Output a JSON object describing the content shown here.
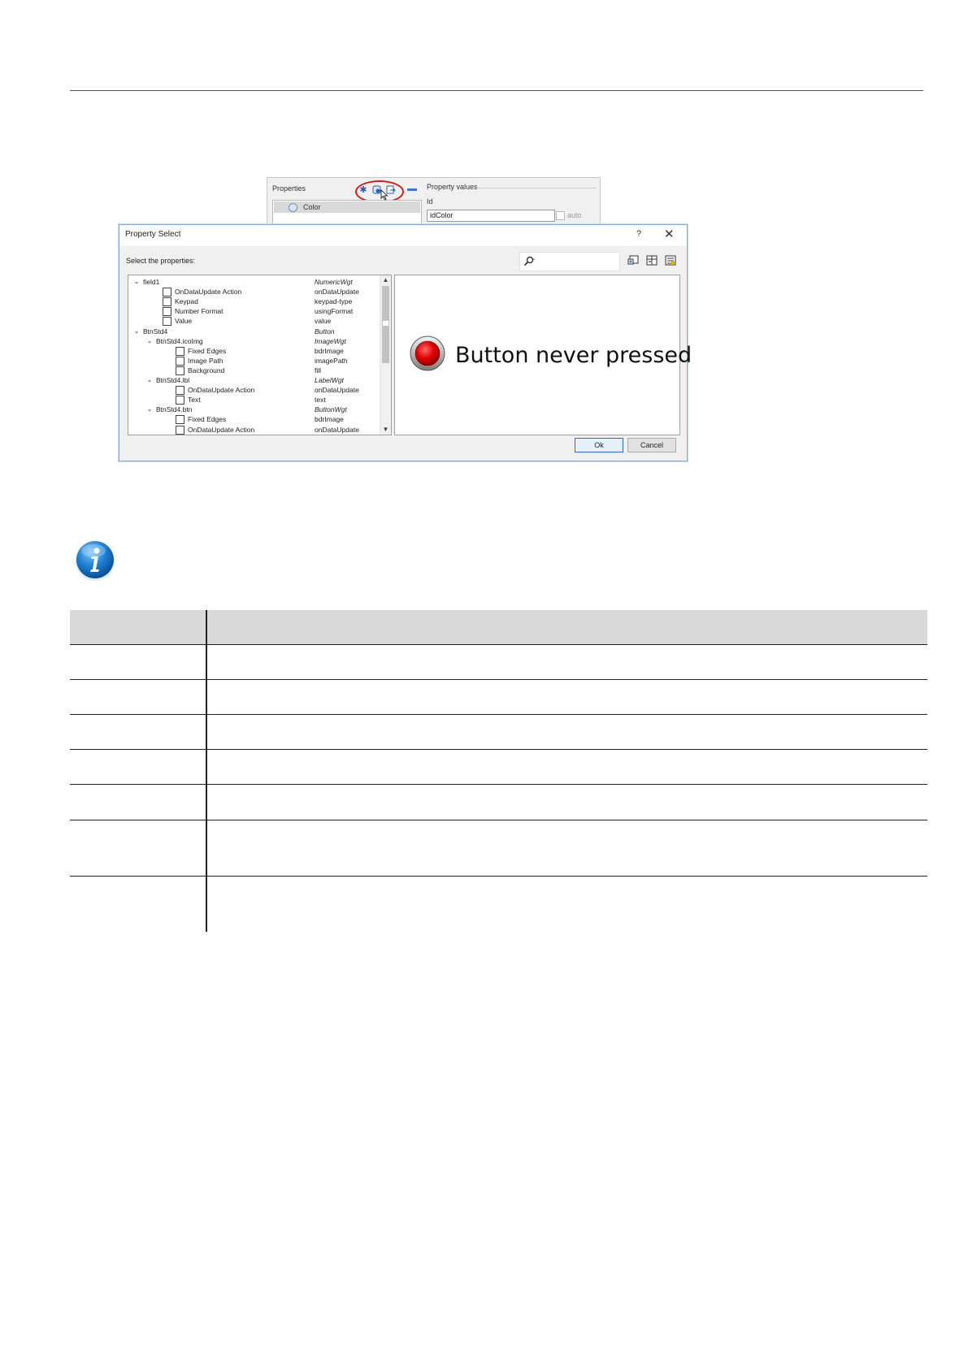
{
  "properties_panel": {
    "label": "Properties",
    "selected_item": "Color",
    "values_label": "Property values",
    "id_label": "Id",
    "id_value": "idColor",
    "auto_label": "auto"
  },
  "dialog": {
    "title": "Property Select",
    "help_glyph": "?",
    "close_glyph": "✕",
    "select_label": "Select the properties:",
    "search_placeholder": "",
    "search_glyph": "-",
    "tree": [
      {
        "level": 0,
        "expander": true,
        "checkbox": false,
        "name": "field1",
        "prop": "NumericWgt",
        "italic": true
      },
      {
        "level": 1,
        "expander": false,
        "checkbox": true,
        "name": "OnDataUpdate Action",
        "prop": "onDataUpdate",
        "italic": false
      },
      {
        "level": 1,
        "expander": false,
        "checkbox": true,
        "name": "Keypad",
        "prop": "keypad-type",
        "italic": false
      },
      {
        "level": 1,
        "expander": false,
        "checkbox": true,
        "name": "Number Format",
        "prop": "usingFormat",
        "italic": false
      },
      {
        "level": 1,
        "expander": false,
        "checkbox": true,
        "name": "Value",
        "prop": "value",
        "italic": false
      },
      {
        "level": 0,
        "expander": true,
        "checkbox": false,
        "name": "BtnStd4",
        "prop": "Button",
        "italic": true
      },
      {
        "level": 1,
        "expander": true,
        "checkbox": false,
        "name": "BtnStd4.icoImg",
        "prop": "ImageWgt",
        "italic": true
      },
      {
        "level": 2,
        "expander": false,
        "checkbox": true,
        "name": "Fixed Edges",
        "prop": "bdrImage",
        "italic": false
      },
      {
        "level": 2,
        "expander": false,
        "checkbox": true,
        "name": "Image Path",
        "prop": "imagePath",
        "italic": false
      },
      {
        "level": 2,
        "expander": false,
        "checkbox": true,
        "name": "Background",
        "prop": "fill",
        "italic": false
      },
      {
        "level": 1,
        "expander": true,
        "checkbox": false,
        "name": "BtnStd4.lbl",
        "prop": "LabelWgt",
        "italic": true
      },
      {
        "level": 2,
        "expander": false,
        "checkbox": true,
        "name": "OnDataUpdate Action",
        "prop": "onDataUpdate",
        "italic": false
      },
      {
        "level": 2,
        "expander": false,
        "checkbox": true,
        "name": "Text",
        "prop": "text",
        "italic": false
      },
      {
        "level": 1,
        "expander": true,
        "checkbox": false,
        "name": "BtnStd4.btn",
        "prop": "ButtonWgt",
        "italic": true
      },
      {
        "level": 2,
        "expander": false,
        "checkbox": true,
        "name": "Fixed Edges",
        "prop": "bdrImage",
        "italic": false
      },
      {
        "level": 2,
        "expander": false,
        "checkbox": true,
        "name": "OnDataUpdate Action",
        "prop": "onDataUpdate",
        "italic": false
      }
    ],
    "preview_text": "Button never pressed",
    "ok_label": "Ok",
    "cancel_label": "Cancel"
  },
  "table": {
    "rows": 7
  },
  "colors": {
    "accent_blue": "#2f6fc0",
    "highlight_red": "#d11c1c",
    "table_header_bg": "#d9d9d9",
    "info_icon_blue": "#1c7fd1"
  }
}
